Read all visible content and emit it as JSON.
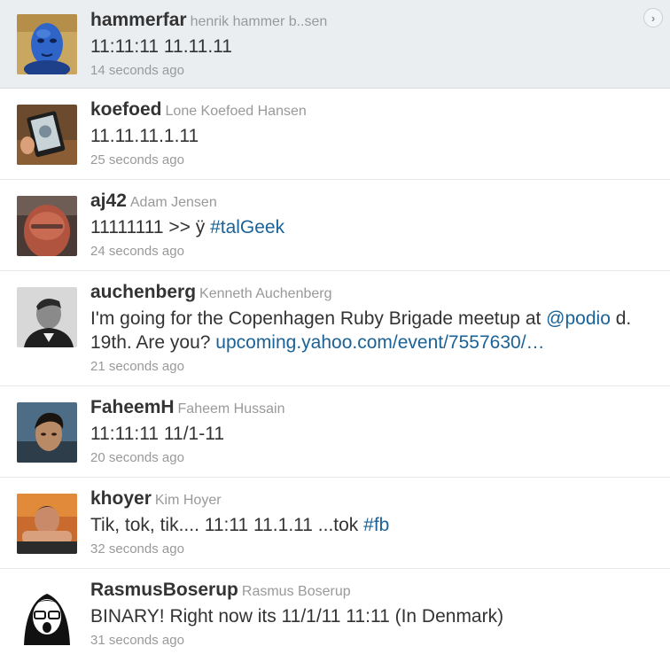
{
  "tweets": [
    {
      "screen_name": "hammerfar",
      "full_name": "henrik hammer b..sen",
      "text": [
        {
          "t": "11:11:11 11.11.11",
          "link": false
        }
      ],
      "time": "14 seconds ago",
      "selected": true,
      "avatar": "avatar-blue-face"
    },
    {
      "screen_name": "koefoed",
      "full_name": "Lone Koefoed Hansen",
      "text": [
        {
          "t": "11.11.11.1.11",
          "link": false
        }
      ],
      "time": "25 seconds ago",
      "avatar": "avatar-tablet"
    },
    {
      "screen_name": "aj42",
      "full_name": "Adam Jensen",
      "text": [
        {
          "t": "11111111 >> ÿ ",
          "link": false
        },
        {
          "t": "#talGeek",
          "link": true
        }
      ],
      "time": "24 seconds ago",
      "avatar": "avatar-red-face"
    },
    {
      "screen_name": "auchenberg",
      "full_name": "Kenneth Auchenberg",
      "text": [
        {
          "t": "I'm going for the Copenhagen Ruby Brigade meetup at ",
          "link": false
        },
        {
          "t": "@podio",
          "link": true
        },
        {
          "t": " d. 19th. Are you? ",
          "link": false
        },
        {
          "t": "upcoming.yahoo.com/event/7557630/…",
          "link": true
        }
      ],
      "time": "21 seconds ago",
      "avatar": "avatar-bw-man"
    },
    {
      "screen_name": "FaheemH",
      "full_name": "Faheem Hussain",
      "text": [
        {
          "t": "11:11:11 11/1-11",
          "link": false
        }
      ],
      "time": "20 seconds ago",
      "avatar": "avatar-dark-hair"
    },
    {
      "screen_name": "khoyer",
      "full_name": "Kim Hoyer",
      "text": [
        {
          "t": "Tik, tok, tik.... 11:11 11.1.11 ...tok ",
          "link": false
        },
        {
          "t": "#fb",
          "link": true
        }
      ],
      "time": "32 seconds ago",
      "avatar": "avatar-hands-face"
    },
    {
      "screen_name": "RasmusBoserup",
      "full_name": "Rasmus Boserup",
      "text": [
        {
          "t": "BINARY! Right now its 11/1/11 11:11 (In Denmark)",
          "link": false
        }
      ],
      "time": "31 seconds ago",
      "avatar": "avatar-cartoon-glasses"
    }
  ],
  "colors": {
    "link": "#1a6297",
    "selected_bg": "#eaeef1",
    "muted": "#999999"
  }
}
